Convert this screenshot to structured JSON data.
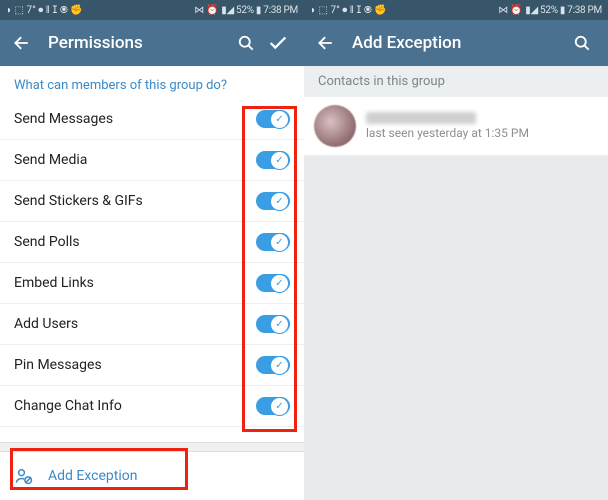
{
  "status": {
    "left_icons": "◗ ⬚ 7° ⏺ ‖ ⵊ ⦿ ✊",
    "right_text": "▮◢ 52% ▮ 7:38 PM",
    "right_icons_prefix": "⋈ ⏰"
  },
  "left": {
    "title": "Permissions",
    "section": "What can members of this group do?",
    "permissions": [
      {
        "label": "Send Messages",
        "on": true
      },
      {
        "label": "Send Media",
        "on": true
      },
      {
        "label": "Send Stickers & GIFs",
        "on": true
      },
      {
        "label": "Send Polls",
        "on": true
      },
      {
        "label": "Embed Links",
        "on": true
      },
      {
        "label": "Add Users",
        "on": true
      },
      {
        "label": "Pin Messages",
        "on": true
      },
      {
        "label": "Change Chat Info",
        "on": true
      }
    ],
    "add_exception": "Add Exception"
  },
  "right": {
    "title": "Add Exception",
    "subheader": "Contacts in this group",
    "contact_status": "last seen yesterday at 1:35 PM"
  },
  "colors": {
    "status_bg": "#37566a",
    "appbar_bg": "#4b7190",
    "accent": "#3a8ac7",
    "toggle": "#3a9ee5",
    "highlight": "#e21"
  }
}
